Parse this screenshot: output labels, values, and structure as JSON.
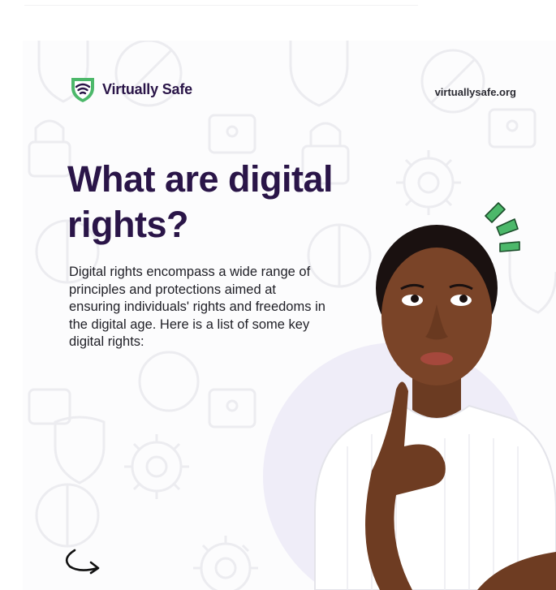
{
  "brand": {
    "name": "Virtually Safe",
    "logo_icon": "wifi-shield-icon",
    "accent_color": "#4cb86a",
    "text_color": "#2a1548"
  },
  "site_url": "virtuallysafe.org",
  "headline": "What are digital rights?",
  "body": "Digital rights encompass a wide range of principles and protections aimed at ensuring individuals' rights and freedoms in the digital age. Here is a list of some key digital rights:",
  "decorations": {
    "background_icons": [
      "shield-icon",
      "padlock-icon",
      "gear-icon",
      "blocked-circle-icon"
    ],
    "accent_marks": "spark-lines-icon",
    "navigation": "curved-arrow-right-icon"
  }
}
